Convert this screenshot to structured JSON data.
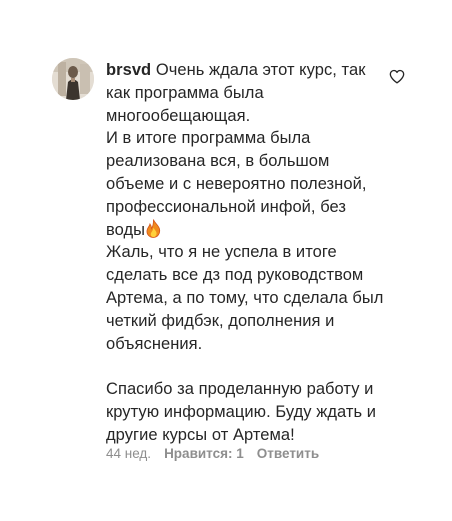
{
  "comment": {
    "username": "brsvd",
    "text_line1": " Очень ждала этот курс, так как программа была многообещающая.\nИ в итоге программа была реализована вся, в большом объеме и с невероятно полезной, профессиональной инфой, без воды",
    "emoji_icon": "fire-emoji",
    "text_line2": "\nЖаль, что я не успела в итоге сделать все дз под руководством Артема, а по тому, что сделала был четкий фидбэк, дополнения и объяснения.\n\nСпасибо за проделанную работу и крутую информацию. Буду ждать и другие курсы от Артема!",
    "time_ago": "44 нед.",
    "likes_label": "Нравится: 1",
    "reply_label": "Ответить",
    "like_icon": "heart-outline-icon"
  },
  "colors": {
    "text": "#262626",
    "meta": "#8e8e8e",
    "background": "#ffffff"
  }
}
